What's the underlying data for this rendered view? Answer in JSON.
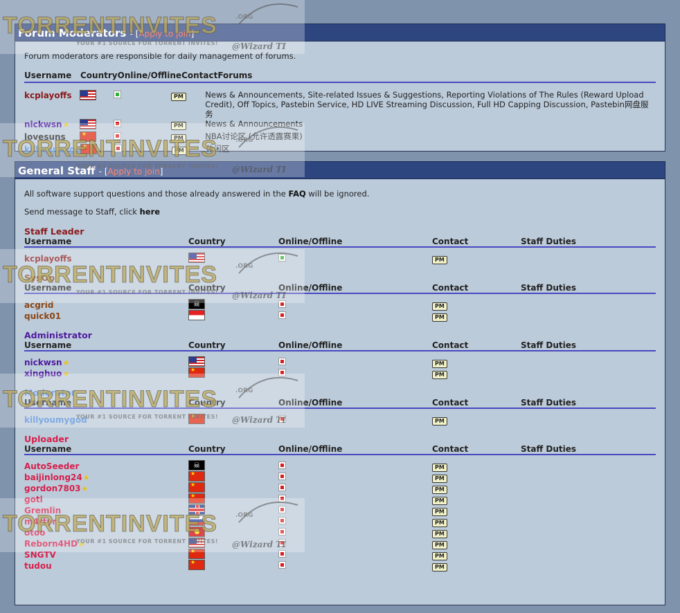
{
  "moderators": {
    "title": "Forum Moderators",
    "apply_open": " - [",
    "apply_link": "Apply to join",
    "apply_close": "]",
    "description": "Forum moderators are responsible for daily management of forums.",
    "headers": [
      "Username",
      "Country",
      "Online/Offline",
      "Contact",
      "Forums"
    ],
    "rows": [
      {
        "name": "kcplayoffs",
        "star": false,
        "flag": "us",
        "online": true,
        "pm": "PM",
        "forums": "News & Announcements, Site-related Issues & Suggestions, Reporting Violations of The Rules (Reward Upload Credit), Off Topics, Pastebin Service, HD LIVE Streaming Discussion, Full HD Capping Discussion, Pastebin网盘服务"
      },
      {
        "name": "nickwsn",
        "star": true,
        "flag": "us",
        "online": false,
        "pm": "PM",
        "forums": "News & Announcements"
      },
      {
        "name": "lovesuns",
        "star": false,
        "flag": "cn",
        "online": false,
        "pm": "PM",
        "forums": "NBA讨论区 (允许透露赛果)"
      },
      {
        "name": "killyoumygod",
        "star": false,
        "flag": "cn",
        "online": false,
        "pm": "PM",
        "forums": "休闲区"
      }
    ]
  },
  "staff": {
    "title": "General Staff",
    "apply_open": " - [",
    "apply_link": "Apply to join",
    "apply_close": "]",
    "desc1_pre": "All software support questions and those already answered in the ",
    "desc1_faq": "FAQ",
    "desc1_post": " will be ignored.",
    "desc2_pre": "Send message to Staff, click ",
    "desc2_here": "here",
    "headers": [
      "Username",
      "Country",
      "Online/Offline",
      "Contact",
      "Staff Duties"
    ],
    "groups": [
      {
        "label": "Staff Leader",
        "members": [
          {
            "name": "kcplayoffs",
            "star": false,
            "flag": "us",
            "online": true,
            "pm": "PM"
          }
        ]
      },
      {
        "label": "SysOp",
        "members": [
          {
            "name": "acgrid",
            "star": false,
            "flag": "pirate",
            "online": false,
            "pm": "PM"
          },
          {
            "name": "quick01",
            "star": false,
            "flag": "sg",
            "online": false,
            "pm": "PM"
          }
        ]
      },
      {
        "label": "Administrator",
        "members": [
          {
            "name": "nickwsn",
            "star": true,
            "flag": "us",
            "online": false,
            "pm": "PM"
          },
          {
            "name": "xinghuo",
            "star": true,
            "flag": "cn",
            "online": false,
            "pm": "PM"
          }
        ]
      },
      {
        "label": "Moderator",
        "members": [
          {
            "name": "killyoumygod",
            "star": false,
            "flag": "cn",
            "online": false,
            "pm": "PM"
          }
        ]
      },
      {
        "label": "Uploader",
        "members": [
          {
            "name": "AutoSeeder",
            "star": false,
            "flag": "pirate",
            "online": false,
            "pm": "PM"
          },
          {
            "name": "baijinlong24",
            "star": true,
            "flag": "cn",
            "online": false,
            "pm": "PM"
          },
          {
            "name": "gordon7803",
            "star": true,
            "flag": "cn",
            "online": false,
            "pm": "PM"
          },
          {
            "name": "goti",
            "star": false,
            "flag": "cn",
            "online": false,
            "pm": "PM"
          },
          {
            "name": "Gremlin",
            "star": false,
            "flag": "uk",
            "online": false,
            "pm": "PM"
          },
          {
            "name": "m4rtyr",
            "star": false,
            "flag": "ru",
            "online": false,
            "pm": "PM"
          },
          {
            "name": "otoo",
            "star": false,
            "flag": "mk",
            "online": false,
            "pm": "PM"
          },
          {
            "name": "Reborn4HD",
            "star": true,
            "flag": "us",
            "online": false,
            "pm": "PM"
          },
          {
            "name": "SNGTV",
            "star": false,
            "flag": "cn",
            "online": false,
            "pm": "PM"
          },
          {
            "name": "tudou",
            "star": false,
            "flag": "cn",
            "online": false,
            "pm": "PM"
          }
        ]
      }
    ]
  },
  "watermark": {
    "title": "TORRENTINVITES",
    "org": ".ORG",
    "subtitle": "YOUR #1 SOURCE FOR TORRENT INVITES!",
    "credit": "@Wizard TI"
  },
  "colors": {
    "header_bar": "#2e4680",
    "panel_bg": "#bccbda",
    "page_bg": "#7f93ad",
    "divider": "#4848c0",
    "apply_link": "#ff5a3c"
  }
}
